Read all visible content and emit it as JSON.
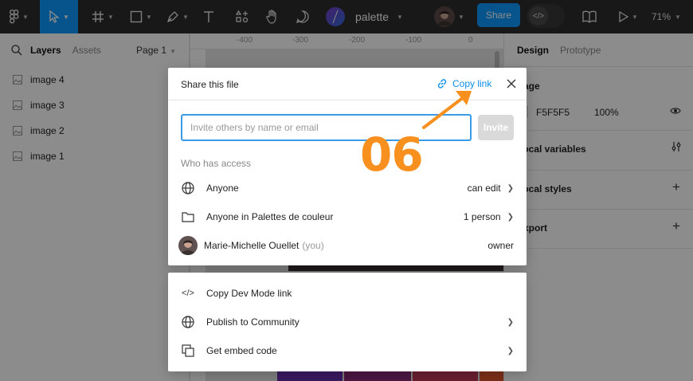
{
  "toolbar": {
    "file_name": "palette",
    "share_label": "Share",
    "dev_mode_glyph": "</>",
    "zoom": "71%",
    "icons": [
      "figma-menu-icon",
      "move-tool-icon",
      "frame-tool-icon",
      "shape-tool-icon",
      "pen-tool-icon",
      "text-tool-icon",
      "resources-icon",
      "hand-tool-icon",
      "comment-icon",
      "library-icon",
      "present-icon"
    ]
  },
  "left_panel": {
    "tabs": [
      "Layers",
      "Assets"
    ],
    "page_label": "Page 1",
    "layers": [
      "image 4",
      "image 3",
      "image 2",
      "image 1"
    ]
  },
  "ruler": {
    "ticks": [
      "-400",
      "-300",
      "-200",
      "-100",
      "0"
    ]
  },
  "right_panel": {
    "tabs": [
      "Design",
      "Prototype"
    ],
    "page_section": "Page",
    "fill_hex": "F5F5F5",
    "fill_opacity": "100%",
    "sections": [
      "Local variables",
      "Local styles",
      "Export"
    ]
  },
  "share_modal": {
    "title": "Share this file",
    "copy_link": "Copy link",
    "invite_placeholder": "Invite others by name or email",
    "invite_button": "Invite",
    "access_label": "Who has access",
    "rows": [
      {
        "name": "Anyone",
        "role": "can edit",
        "icon": "globe-icon"
      },
      {
        "name": "Anyone in Palettes de couleur",
        "role": "1 person",
        "icon": "folder-icon"
      },
      {
        "name": "Marie-Michelle Ouellet",
        "suffix": "(you)",
        "role": "owner",
        "icon": "avatar"
      }
    ]
  },
  "more_menu": {
    "items": [
      {
        "label": "Copy Dev Mode link",
        "icon": "code-icon"
      },
      {
        "label": "Publish to Community",
        "icon": "globe-icon"
      },
      {
        "label": "Get embed code",
        "icon": "embed-icon"
      }
    ]
  },
  "annotation": {
    "step": "06",
    "color": "#f7901e"
  },
  "colors": {
    "accent": "#0d99ff",
    "toolbar_bg": "#2c2c2c",
    "link": "#0c8ce9"
  }
}
